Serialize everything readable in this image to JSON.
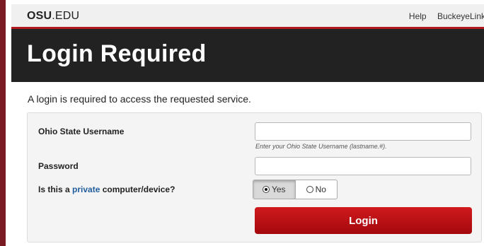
{
  "header": {
    "brand_bold": "OSU",
    "brand_rest": ".EDU",
    "links": [
      "Help",
      "BuckeyeLink"
    ]
  },
  "hero": {
    "title": "Login Required"
  },
  "intro": "A login is required to access the requested service.",
  "form": {
    "username_label": "Ohio State Username",
    "username_value": "",
    "username_hint": "Enter your Ohio State Username (lastname.#).",
    "password_label": "Password",
    "password_value": "",
    "private_label_prefix": "Is this a ",
    "private_label_link": "private",
    "private_label_suffix": " computer/device?",
    "private_options": [
      "Yes",
      "No"
    ],
    "private_selected": "Yes",
    "login_label": "Login"
  },
  "colors": {
    "accent": "#b11a1f",
    "hero_bg": "#222222",
    "link": "#1f5d9c"
  }
}
